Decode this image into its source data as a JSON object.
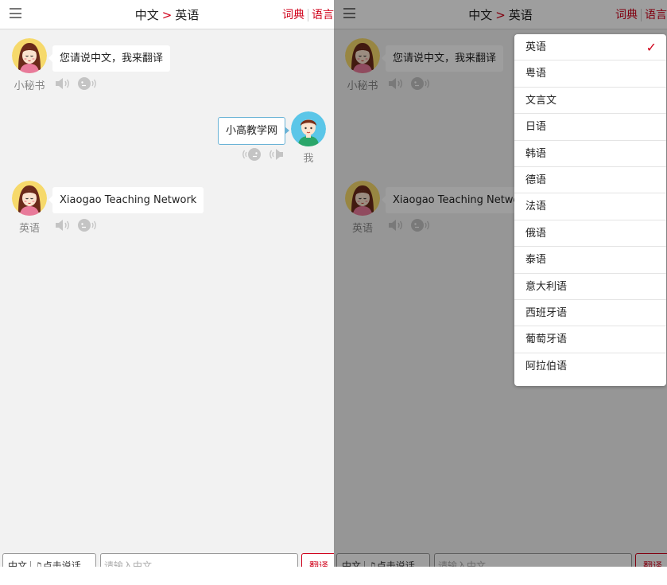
{
  "header": {
    "source_lang": "中文",
    "separator": ">",
    "target_lang": "英语",
    "link_dictionary": "词典",
    "link_language": "语言"
  },
  "chat": {
    "assistant_name": "小秘书",
    "assistant_message": "您请说中文，我来翻译",
    "user_name": "我",
    "user_message": "小高教学网",
    "reply_name": "英语",
    "reply_message": "Xiaogao Teaching Network"
  },
  "bottom": {
    "lang_button": "中文",
    "voice_button": "点击说话",
    "input_placeholder": "请输入中文",
    "translate_button": "翻译"
  },
  "language_menu": {
    "selected": "英语",
    "items": [
      "英语",
      "粤语",
      "文言文",
      "日语",
      "韩语",
      "德语",
      "法语",
      "俄语",
      "泰语",
      "意大利语",
      "西班牙语",
      "葡萄牙语",
      "阿拉伯语"
    ]
  },
  "icons": {
    "menu": "hamburger-icon",
    "speaker": "speaker-icon",
    "voice": "voice-icon",
    "check": "check-icon",
    "mic": "mic-icon"
  },
  "colors": {
    "accent": "#d0021b",
    "user_bubble_border": "#6ab3d6",
    "background": "#f2f2f2"
  }
}
